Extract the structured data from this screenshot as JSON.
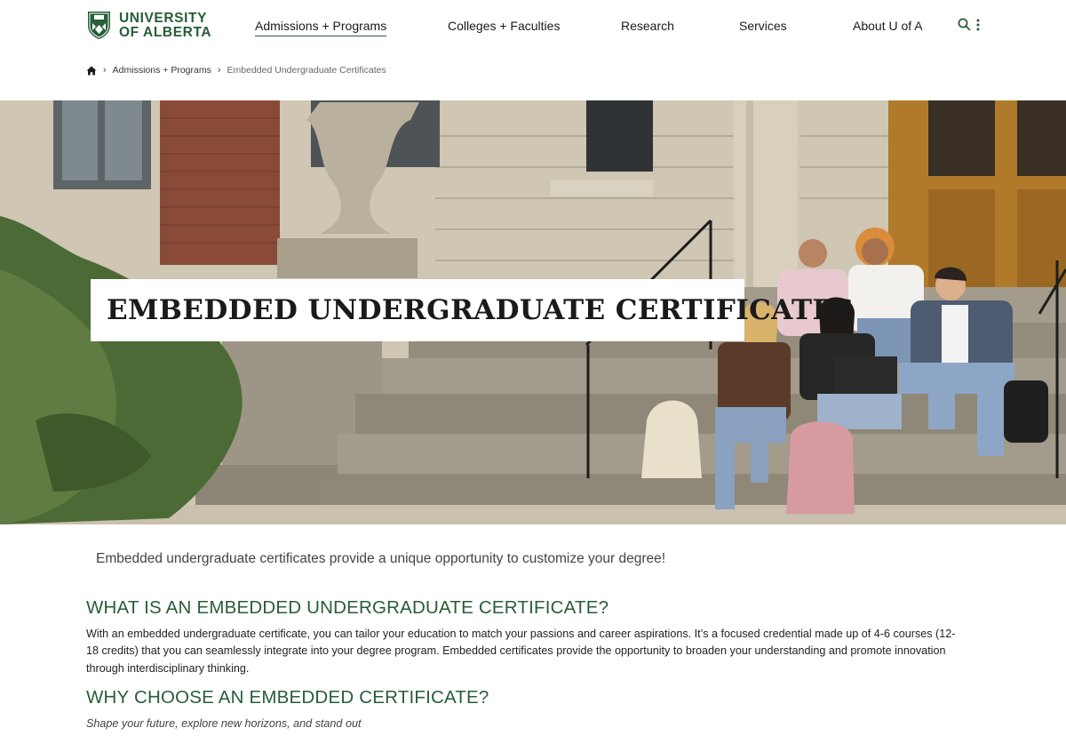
{
  "brand": {
    "line1": "UNIVERSITY",
    "line2": "OF ALBERTA",
    "color": "#275d38"
  },
  "nav": {
    "items": [
      {
        "label": "Admissions + Programs",
        "active": true
      },
      {
        "label": "Colleges + Faculties",
        "active": false
      },
      {
        "label": "Research",
        "active": false
      },
      {
        "label": "Services",
        "active": false
      },
      {
        "label": "About U of A",
        "active": false
      }
    ],
    "icons": [
      "search-icon",
      "more-vertical-icon"
    ]
  },
  "breadcrumb": {
    "home_icon": "home-icon",
    "items": [
      "Admissions + Programs",
      "Embedded Undergraduate Certificates"
    ]
  },
  "hero": {
    "title": "EMBEDDED UNDERGRADUATE CERTIFICATES"
  },
  "content": {
    "intro": "Embedded undergraduate certificates provide a unique opportunity to customize your degree!",
    "section1_heading": "WHAT IS AN EMBEDDED UNDERGRADUATE CERTIFICATE?",
    "section1_body": "With an embedded undergraduate certificate, you can tailor your education to match your passions and career aspirations. It’s a focused credential made up of 4-6 courses (12-18 credits) that you can seamlessly integrate into your degree program. Embedded certificates provide the opportunity to broaden your understanding and promote innovation through interdisciplinary thinking.",
    "section2_heading": "WHY CHOOSE AN EMBEDDED CERTIFICATE?",
    "section2_sub": "Shape your future, explore new horizons, and stand out"
  }
}
